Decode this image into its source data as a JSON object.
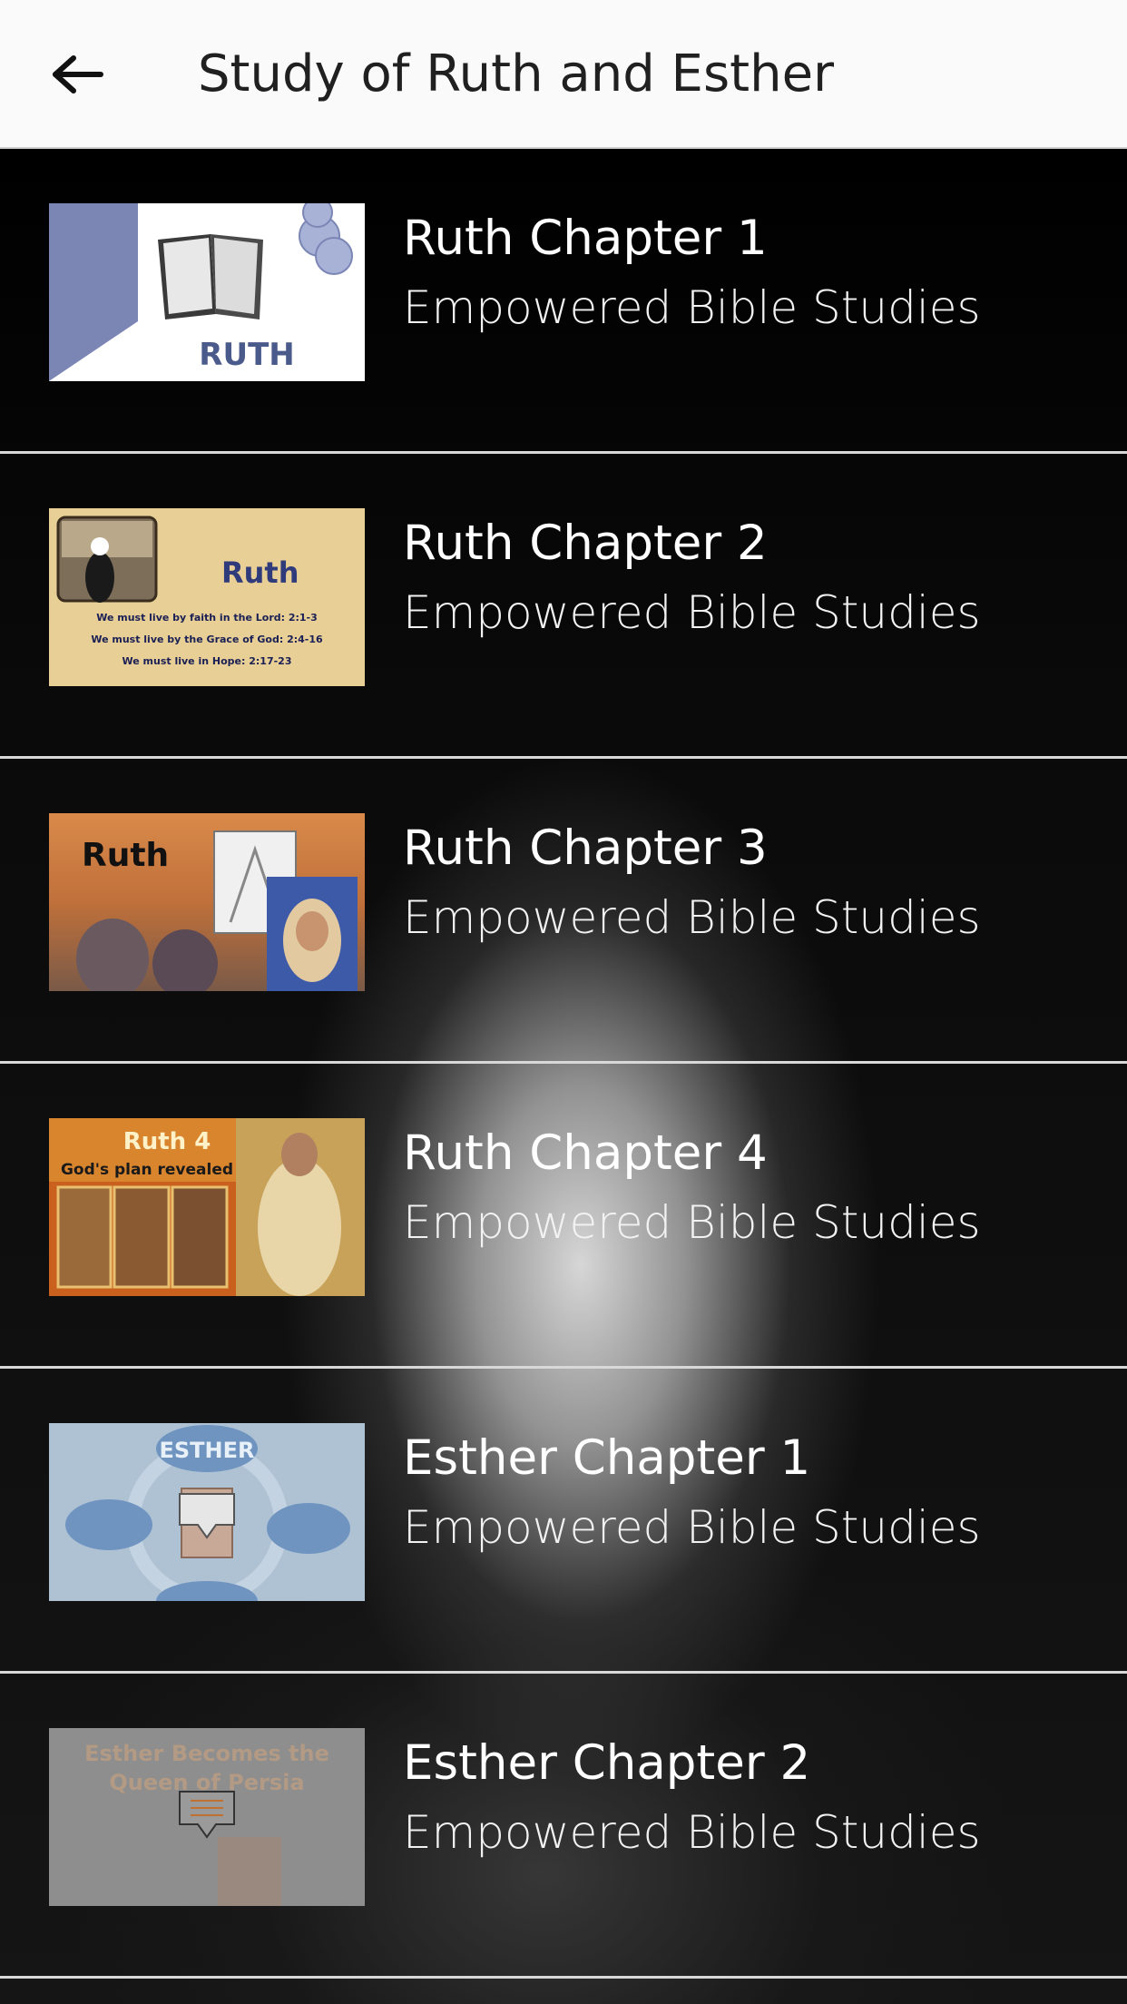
{
  "header": {
    "title": "Study of Ruth and Esther",
    "back_icon": "arrow-left-icon"
  },
  "items": [
    {
      "title": "Ruth Chapter 1",
      "subtitle": "Empowered Bible Studies",
      "thumb_text": [
        "RUTH"
      ]
    },
    {
      "title": "Ruth Chapter 2",
      "subtitle": "Empowered Bible Studies",
      "thumb_text": [
        "Ruth",
        "We must live by faith in the Lord: 2:1-3",
        "We must live by the Grace of God: 2:4-16",
        "We must live in Hope: 2:17-23"
      ]
    },
    {
      "title": "Ruth Chapter 3",
      "subtitle": "Empowered Bible Studies",
      "thumb_text": [
        "Ruth"
      ]
    },
    {
      "title": "Ruth Chapter 4",
      "subtitle": "Empowered Bible Studies",
      "thumb_text": [
        "Ruth 4",
        "God's plan revealed"
      ]
    },
    {
      "title": "Esther Chapter 1",
      "subtitle": "Empowered Bible Studies",
      "thumb_text": [
        "ESTHER"
      ]
    },
    {
      "title": "Esther Chapter 2",
      "subtitle": "Empowered Bible Studies",
      "thumb_text": [
        "Esther Becomes the",
        "Queen of Persia"
      ]
    }
  ]
}
